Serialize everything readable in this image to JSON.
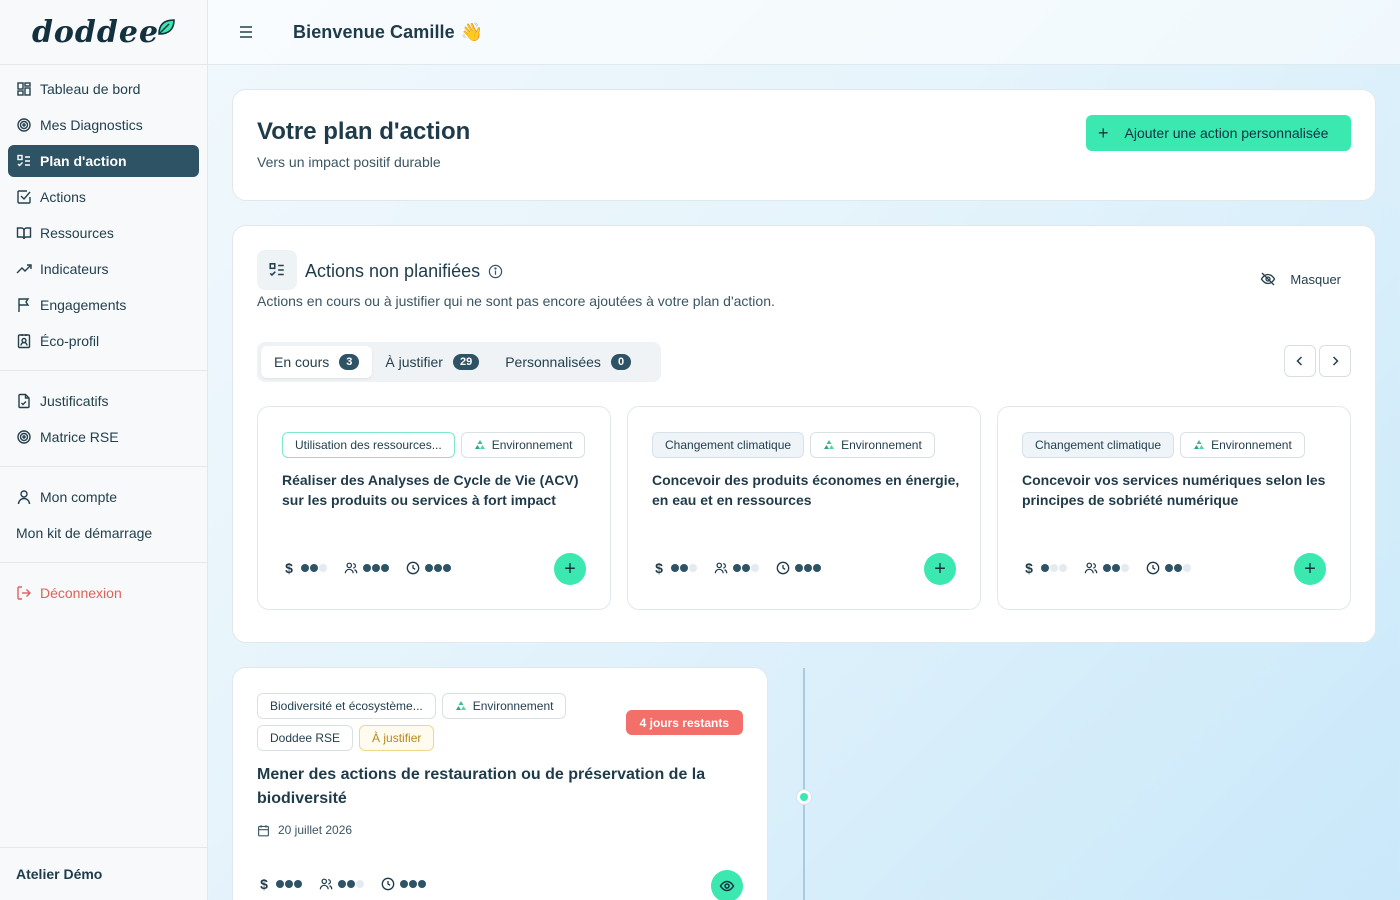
{
  "app": {
    "logo_text": "doddee"
  },
  "header": {
    "welcome": "Bienvenue Camille",
    "wave_emoji": "👋"
  },
  "sidebar": {
    "items": [
      {
        "label": "Tableau de bord",
        "icon": "dashboard-icon"
      },
      {
        "label": "Mes Diagnostics",
        "icon": "target-icon"
      },
      {
        "label": "Plan d'action",
        "icon": "checklist-icon",
        "active": true
      },
      {
        "label": "Actions",
        "icon": "check-square-icon"
      },
      {
        "label": "Ressources",
        "icon": "book-icon"
      },
      {
        "label": "Indicateurs",
        "icon": "trending-up-icon"
      },
      {
        "label": "Engagements",
        "icon": "flag-icon"
      },
      {
        "label": "Éco-profil",
        "icon": "id-badge-icon"
      }
    ],
    "items2": [
      {
        "label": "Justificatifs",
        "icon": "file-check-icon"
      },
      {
        "label": "Matrice RSE",
        "icon": "target-icon"
      }
    ],
    "items3": [
      {
        "label": "Mon compte",
        "icon": "user-icon"
      },
      {
        "label": "Mon kit de démarrage"
      }
    ],
    "logout": "Déconnexion",
    "footer": "Atelier Démo"
  },
  "plan": {
    "title": "Votre plan d'action",
    "subtitle": "Vers un impact positif durable",
    "add_button": "Ajouter une action personnalisée"
  },
  "unplanned": {
    "title": "Actions non planifiées",
    "description": "Actions en cours ou à justifier qui ne sont pas encore ajoutées à votre plan d'action.",
    "hide_label": "Masquer",
    "tabs": [
      {
        "label": "En cours",
        "count": "3",
        "active": true
      },
      {
        "label": "À justifier",
        "count": "29"
      },
      {
        "label": "Personnalisées",
        "count": "0"
      }
    ],
    "cards": [
      {
        "tags": [
          "Utilisation des ressources...",
          "Environnement"
        ],
        "title": "Réaliser des Analyses de Cycle de Vie (ACV) sur les produits ou services à fort impact",
        "cost": 2,
        "people": 3,
        "time": 3
      },
      {
        "tags": [
          "Changement climatique",
          "Environnement"
        ],
        "title": "Concevoir des produits économes en énergie, en eau et en ressources",
        "cost": 2,
        "people": 2,
        "time": 3
      },
      {
        "tags": [
          "Changement climatique",
          "Environnement"
        ],
        "title": "Concevoir vos services numériques selon les principes de sobriété numérique",
        "cost": 1,
        "people": 2,
        "time": 2
      }
    ]
  },
  "planned": {
    "tags": [
      "Biodiversité et écosystème...",
      "Environnement",
      "Doddee RSE",
      "À justifier"
    ],
    "deadline": "4 jours restants",
    "title": "Mener des actions de restauration ou de préservation de la biodiversité",
    "date": "20 juillet 2026",
    "cost": 3,
    "people": 2,
    "time": 3
  },
  "colors": {
    "accent": "#3be8b0",
    "primary": "#2d5364",
    "danger": "#f26f6a"
  }
}
